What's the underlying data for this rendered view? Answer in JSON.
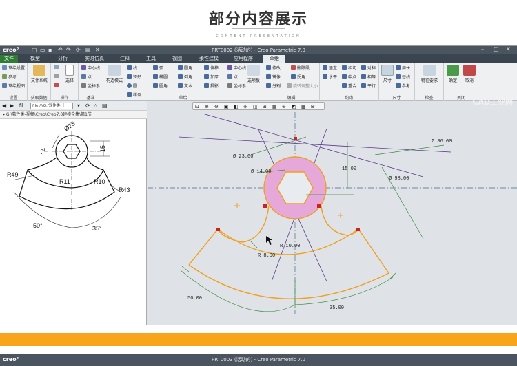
{
  "header": {
    "title": "部分内容展示",
    "subtitle": "CONTENT PRESENTATION"
  },
  "app": {
    "logo": "creo°",
    "window_title": "PRT0002 (活动的) - Creo Parametric 7.0",
    "watermark": "CAD工业网",
    "watermark_url": "www.cadzx.com"
  },
  "tabs": [
    "文件",
    "模型",
    "分析",
    "实时仿真",
    "注释",
    "工具",
    "视图",
    "柔性建模",
    "应用程序",
    "草绘"
  ],
  "ribbon": {
    "groups": {
      "settings": "设置",
      "get_data": "获取数据",
      "operations": "操作",
      "datum": "基准",
      "sketch": "草绘",
      "edit": "编辑",
      "constrain": "约束",
      "dimension": "尺寸",
      "inspect": "检查",
      "close": "关闭"
    },
    "settings": [
      "草绘设置",
      "参考",
      "草绘视图"
    ],
    "file_system": "文件系统",
    "select": "选择",
    "datum": [
      "中心线",
      "点",
      "坐标系"
    ],
    "construction": "构造模式",
    "sketch_col1": [
      "线",
      "矩形",
      "圆",
      "样条"
    ],
    "sketch_col2": [
      "弧",
      "椭圆",
      "圆角"
    ],
    "sketch_col3": [
      "圆角",
      "倒角",
      "文本"
    ],
    "sketch_col4": [
      "偏移",
      "加厚",
      "投影"
    ],
    "sketch_col5": [
      "中心线",
      "点",
      "坐标系"
    ],
    "palette": "选项板",
    "edit": [
      "修改",
      "删除段",
      "镜像",
      "拐角",
      "分割",
      "旋转调整大小"
    ],
    "constrain": [
      "竖直",
      "相切",
      "对称",
      "水平",
      "中点",
      "相等",
      "重合",
      "平行"
    ],
    "dimension": [
      "尺寸",
      "周长",
      "基线",
      "参考"
    ],
    "inspect": "特征要求",
    "confirm": "确定",
    "cancel": "取消"
  },
  "nav": {
    "file_label": "fil",
    "file_box": "file:///G:/软件类-十",
    "address": "G:\\软件类-视频\\Creo\\Creo7.0建模全集\\第1节"
  },
  "reference_drawing": {
    "dims": [
      "Ø23",
      "15",
      "14",
      "R49",
      "R10",
      "R11",
      "R43",
      "50°",
      "35°"
    ]
  },
  "sketch": {
    "dims": [
      "Ø 23.00",
      "Ø 14.00",
      "Ø 86.00",
      "Ø 98.00",
      "15.00",
      "R 10.00",
      "R 8.00",
      "50.00",
      "35.00"
    ],
    "colors": {
      "orange": "#f0a020",
      "pink": "#e6a8d8",
      "purple": "#5a3a8a",
      "green": "#3c8a3c"
    }
  },
  "second_window": {
    "title": "PRT0003 (活动的) - Creo Parametric 7.0",
    "logo": "creo°"
  }
}
